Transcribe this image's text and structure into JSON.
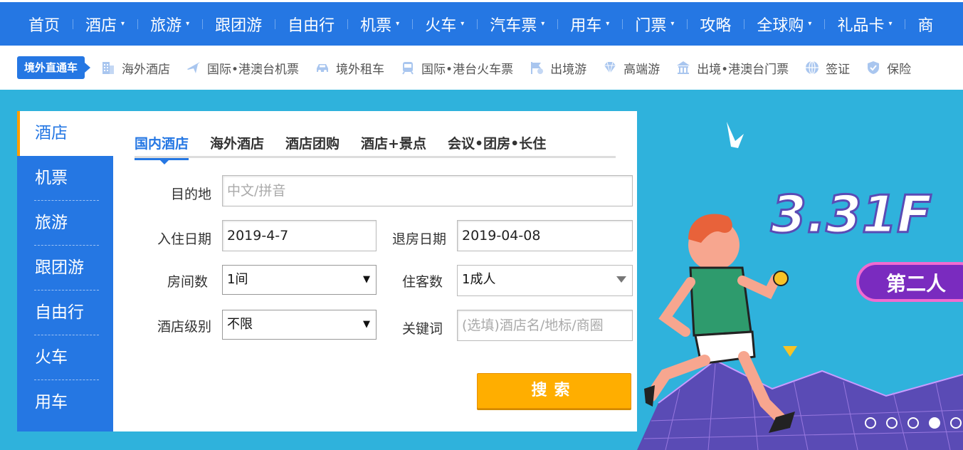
{
  "topnav": {
    "items": [
      {
        "label": "首页",
        "caret": ""
      },
      {
        "label": "酒店",
        "caret": "▾"
      },
      {
        "label": "旅游",
        "caret": "▾"
      },
      {
        "label": "跟团游",
        "caret": ""
      },
      {
        "label": "自由行",
        "caret": ""
      },
      {
        "label": "机票",
        "caret": "▾"
      },
      {
        "label": "火车",
        "caret": "▾"
      },
      {
        "label": "汽车票",
        "caret": "▾"
      },
      {
        "label": "用车",
        "caret": "▾"
      },
      {
        "label": "门票",
        "caret": "▾"
      },
      {
        "label": "攻略",
        "caret": ""
      },
      {
        "label": "全球购",
        "caret": "▾"
      },
      {
        "label": "礼品卡",
        "caret": "▾"
      },
      {
        "label": "商",
        "caret": ""
      }
    ]
  },
  "subnav": {
    "badge": "境外直通车",
    "items": [
      {
        "label": "海外酒店",
        "icon": "building-icon"
      },
      {
        "label": "国际•港澳台机票",
        "icon": "plane-icon"
      },
      {
        "label": "境外租车",
        "icon": "car-icon"
      },
      {
        "label": "国际•港台火车票",
        "icon": "train-icon"
      },
      {
        "label": "出境游",
        "icon": "flag-icon"
      },
      {
        "label": "高端游",
        "icon": "diamond-icon"
      },
      {
        "label": "出境•港澳台门票",
        "icon": "temple-icon"
      },
      {
        "label": "签证",
        "icon": "globe-icon"
      },
      {
        "label": "保险",
        "icon": "shield-icon"
      }
    ]
  },
  "leftnav": {
    "items": [
      "酒店",
      "机票",
      "旅游",
      "跟团游",
      "自由行",
      "火车",
      "用车"
    ],
    "active_index": 0
  },
  "tabs": {
    "items": [
      "国内酒店",
      "海外酒店",
      "酒店团购",
      "酒店+景点",
      "会议•团房•长住"
    ],
    "active_index": 0
  },
  "form": {
    "destination_label": "目的地",
    "destination_placeholder": "中文/拼音",
    "checkin_label": "入住日期",
    "checkin_value": "2019-4-7",
    "checkout_label": "退房日期",
    "checkout_value": "2019-04-08",
    "rooms_label": "房间数",
    "rooms_value": "1间",
    "guests_label": "住客数",
    "guests_value": "1成人",
    "level_label": "酒店级别",
    "level_value": "不限",
    "keyword_label": "关键词",
    "keyword_placeholder": "(选填)酒店名/地标/商圈",
    "search_label": "搜索"
  },
  "banner": {
    "headline": "3.31",
    "headline_tail": "F",
    "tag": "第二人",
    "slides_total": 5,
    "slide_active": 4
  },
  "colors": {
    "primary": "#2577e3",
    "accent": "#ff9d00",
    "button": "#ffae00",
    "background": "#2fb2dc"
  }
}
